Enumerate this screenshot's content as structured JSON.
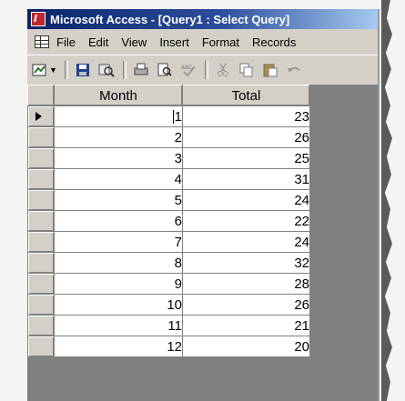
{
  "window": {
    "title": "Microsoft Access - [Query1 : Select Query]"
  },
  "menu": {
    "items": [
      "File",
      "Edit",
      "View",
      "Insert",
      "Format",
      "Records"
    ]
  },
  "toolbar": {
    "buttons": [
      "view-icon",
      "save-icon",
      "search-icon",
      "print-icon",
      "print-preview-icon",
      "spelling-icon",
      "cut-icon",
      "copy-icon",
      "paste-icon",
      "undo-icon"
    ]
  },
  "datasheet": {
    "columns": [
      "Month",
      "Total"
    ],
    "rows": [
      {
        "month": "1",
        "total": "23"
      },
      {
        "month": "2",
        "total": "26"
      },
      {
        "month": "3",
        "total": "25"
      },
      {
        "month": "4",
        "total": "31"
      },
      {
        "month": "5",
        "total": "24"
      },
      {
        "month": "6",
        "total": "22"
      },
      {
        "month": "7",
        "total": "24"
      },
      {
        "month": "8",
        "total": "32"
      },
      {
        "month": "9",
        "total": "28"
      },
      {
        "month": "10",
        "total": "26"
      },
      {
        "month": "11",
        "total": "21"
      },
      {
        "month": "12",
        "total": "20"
      }
    ]
  },
  "colors": {
    "titlebar": "#0a246a",
    "chrome": "#d4d0c8",
    "empty_area": "#808080"
  }
}
